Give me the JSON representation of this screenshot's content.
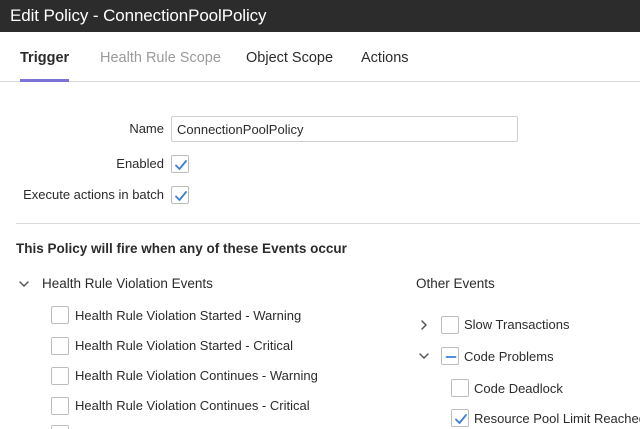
{
  "window": {
    "title": "Edit Policy - ConnectionPoolPolicy"
  },
  "tabs": [
    {
      "label": "Trigger",
      "state": "active"
    },
    {
      "label": "Health Rule Scope",
      "state": "disabled"
    },
    {
      "label": "Object Scope",
      "state": "normal"
    },
    {
      "label": "Actions",
      "state": "normal"
    }
  ],
  "form": {
    "name_label": "Name",
    "name_value": "ConnectionPoolPolicy",
    "enabled_label": "Enabled",
    "enabled_checked": true,
    "batch_label": "Execute actions in batch",
    "batch_checked": true
  },
  "events": {
    "section_title": "This Policy will fire when any of these Events occur",
    "health_group": {
      "title": "Health Rule Violation Events",
      "expanded": true,
      "items": [
        {
          "label": "Health Rule Violation Started - Warning",
          "checked": false
        },
        {
          "label": "Health Rule Violation Started - Critical",
          "checked": false
        },
        {
          "label": "Health Rule Violation Continues - Warning",
          "checked": false
        },
        {
          "label": "Health Rule Violation Continues - Critical",
          "checked": false
        }
      ]
    },
    "other_group": {
      "title": "Other Events",
      "items": [
        {
          "label": "Slow Transactions",
          "state": "unchecked",
          "expanded": false
        },
        {
          "label": "Code Problems",
          "state": "indeterminate",
          "expanded": true
        },
        {
          "label": "Code Deadlock",
          "state": "unchecked"
        },
        {
          "label": "Resource Pool Limit Reached",
          "state": "checked"
        }
      ]
    }
  },
  "colors": {
    "titlebar_bg": "#2c2c2c",
    "accent": "#7b73d6",
    "check": "#3d7fd6"
  },
  "icons": {
    "check": "checkmark-icon",
    "indeterminate": "minus-icon",
    "expanded": "chevron-down-icon",
    "collapsed": "chevron-right-icon"
  }
}
